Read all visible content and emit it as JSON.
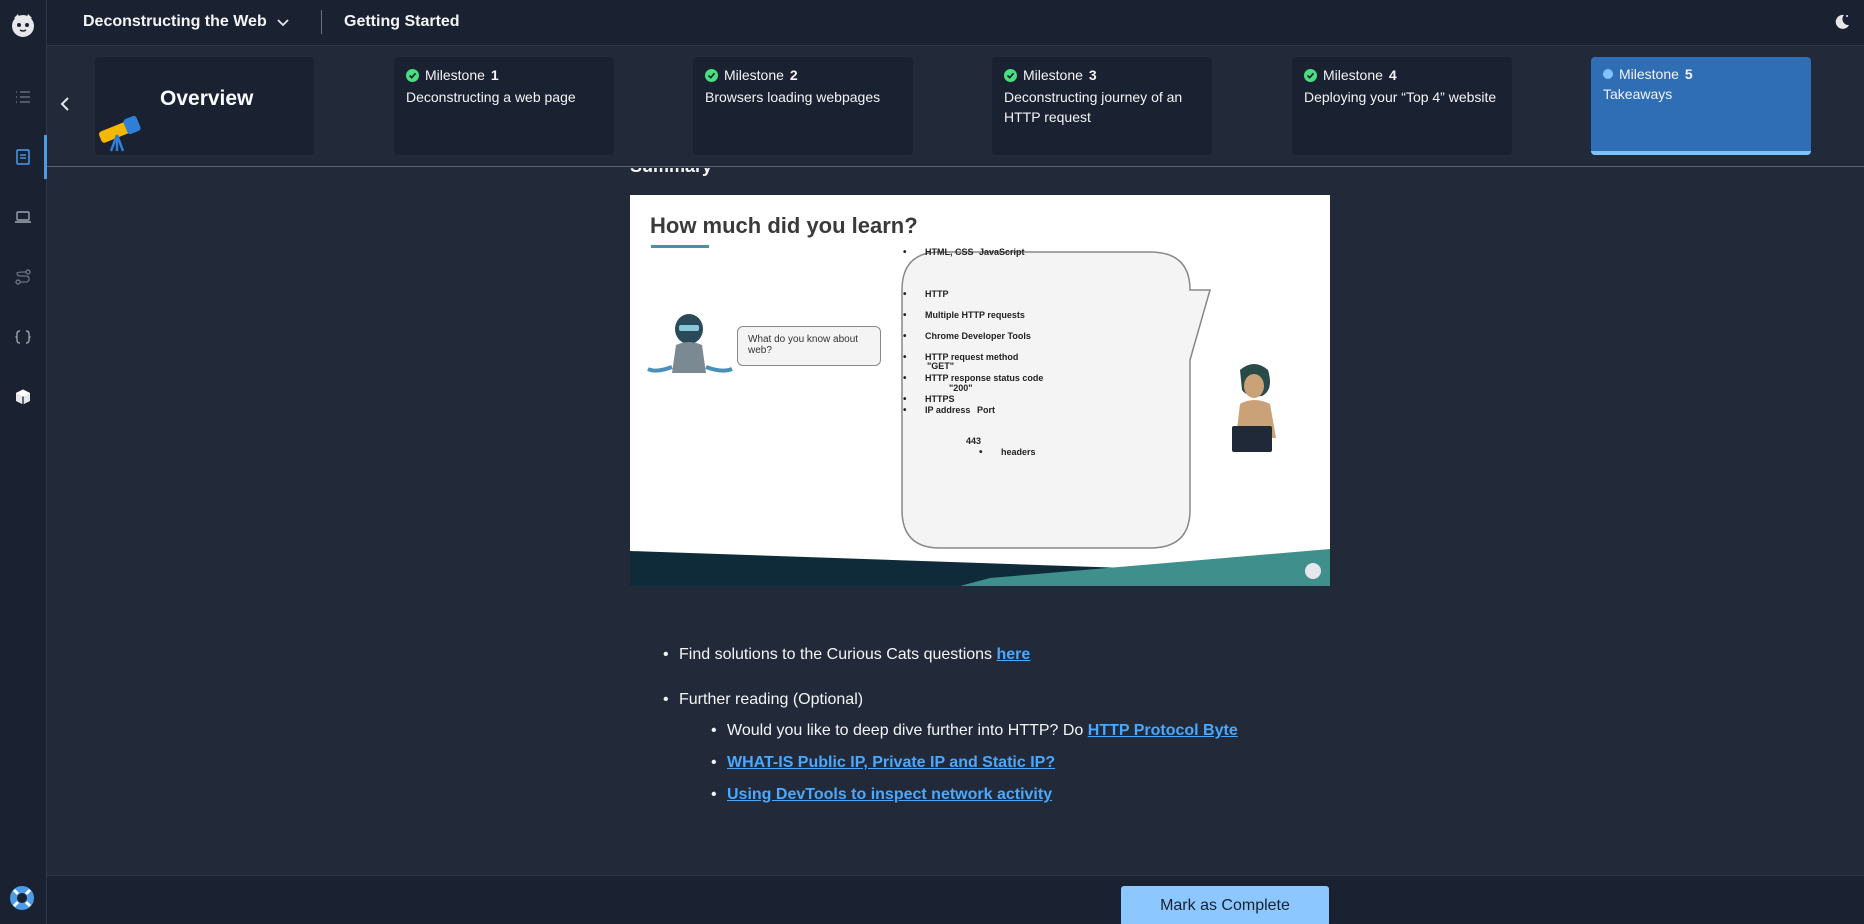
{
  "header": {
    "course_title": "Deconstructing the Web",
    "section_title": "Getting Started"
  },
  "milestones": {
    "overview_label": "Overview",
    "items": [
      {
        "prefix": "Milestone",
        "number": "1",
        "desc": "Deconstructing a web page",
        "status": "complete"
      },
      {
        "prefix": "Milestone",
        "number": "2",
        "desc": "Browsers loading webpages",
        "status": "complete"
      },
      {
        "prefix": "Milestone",
        "number": "3",
        "desc": "Deconstructing journey of an HTTP request",
        "status": "complete"
      },
      {
        "prefix": "Milestone",
        "number": "4",
        "desc": "Deploying your “Top 4” website",
        "status": "complete"
      },
      {
        "prefix": "Milestone",
        "number": "5",
        "desc": "Takeaways",
        "status": "current"
      }
    ]
  },
  "content": {
    "section_heading": "Summary",
    "slide": {
      "title": "How much did you learn?",
      "question": "What do you know about web?",
      "list": [
        "HTML, CSS",
        "JavaScript",
        "HTTP",
        "Multiple HTTP requests",
        "Chrome Developer Tools",
        "HTTP request method",
        "\"GET\"",
        "HTTP response status code",
        "\"200\"",
        "HTTPS",
        "IP address",
        "Port",
        "443",
        "headers"
      ]
    },
    "bullets": {
      "solutions_text": "Find solutions to the Curious Cats questions ",
      "solutions_link": "here",
      "further_reading": "Further reading (Optional)",
      "deep_dive_text": "Would you like to deep dive further into HTTP? Do ",
      "deep_dive_link": "HTTP Protocol Byte",
      "link_ip": "WHAT-IS Public IP, Private IP and Static IP?",
      "link_devtools": "Using DevTools to inspect network activity"
    }
  },
  "footer": {
    "complete_label": "Mark as Complete"
  },
  "colors": {
    "accent": "#2f6db5",
    "link": "#4aa8ff",
    "complete": "#4ade80",
    "button": "#8cc8ff"
  }
}
